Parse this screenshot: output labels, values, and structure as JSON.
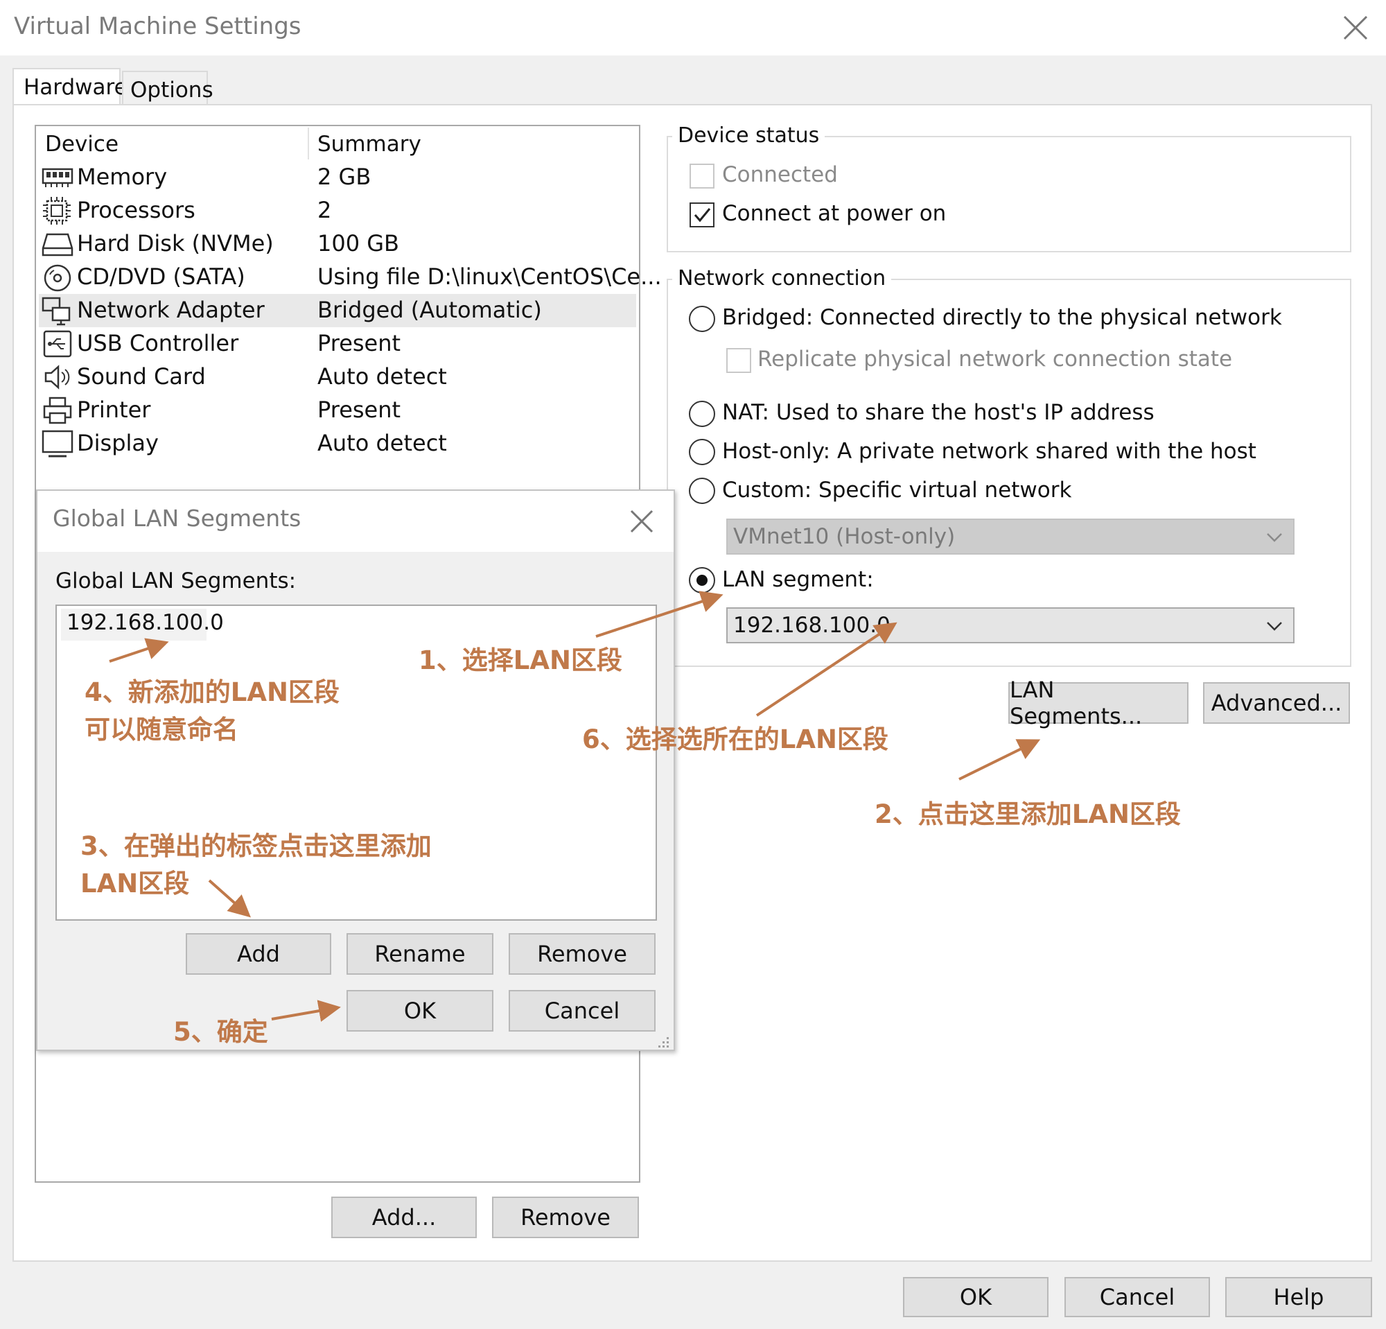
{
  "window": {
    "title": "Virtual Machine Settings",
    "tabs": [
      "Hardware",
      "Options"
    ]
  },
  "device_list": {
    "header_device": "Device",
    "header_summary": "Summary",
    "rows": [
      {
        "icon": "memory-icon",
        "label": "Memory",
        "summary": "2 GB"
      },
      {
        "icon": "processor-icon",
        "label": "Processors",
        "summary": "2"
      },
      {
        "icon": "hard-disk-icon",
        "label": "Hard Disk (NVMe)",
        "summary": "100 GB"
      },
      {
        "icon": "cd-dvd-icon",
        "label": "CD/DVD (SATA)",
        "summary": "Using file D:\\linux\\CentOS\\Ce..."
      },
      {
        "icon": "network-adapter-icon",
        "label": "Network Adapter",
        "summary": "Bridged (Automatic)"
      },
      {
        "icon": "usb-icon",
        "label": "USB Controller",
        "summary": "Present"
      },
      {
        "icon": "sound-card-icon",
        "label": "Sound Card",
        "summary": "Auto detect"
      },
      {
        "icon": "printer-icon",
        "label": "Printer",
        "summary": "Present"
      },
      {
        "icon": "display-icon",
        "label": "Display",
        "summary": "Auto detect"
      }
    ],
    "selected_index": 4,
    "add_label": "Add...",
    "remove_label": "Remove"
  },
  "device_status": {
    "title": "Device status",
    "connected_label": "Connected",
    "connected_checked": false,
    "connect_power_on_label": "Connect at power on",
    "connect_power_on_checked": true
  },
  "network_connection": {
    "title": "Network connection",
    "bridged_label": "Bridged: Connected directly to the physical network",
    "replicate_label": "Replicate physical network connection state",
    "nat_label": "NAT: Used to share the host's IP address",
    "hostonly_label": "Host-only: A private network shared with the host",
    "custom_label": "Custom: Specific virtual network",
    "custom_select_value": "VMnet10 (Host-only)",
    "lan_label": "LAN segment:",
    "lan_select_value": "192.168.100.0",
    "selected": "lan"
  },
  "right_buttons": {
    "lan_segments_label": "LAN Segments...",
    "advanced_label": "Advanced..."
  },
  "footer": {
    "ok_label": "OK",
    "cancel_label": "Cancel",
    "help_label": "Help"
  },
  "lan_dialog": {
    "title": "Global LAN Segments",
    "list_label": "Global LAN Segments:",
    "items": [
      "192.168.100.0"
    ],
    "add_label": "Add",
    "rename_label": "Rename",
    "remove_label": "Remove",
    "ok_label": "OK",
    "cancel_label": "Cancel"
  },
  "annotations": {
    "step1": "1、选择LAN区段",
    "step2": "2、点击这里添加LAN区段",
    "step3_line1": "3、在弹出的标签点击这里添加",
    "step3_line2": "LAN区段",
    "step4_line1": "4、新添加的LAN区段",
    "step4_line2": "可以随意命名",
    "step5": "5、确定",
    "step6": "6、选择选所在的LAN区段",
    "color": "#c0794a"
  }
}
